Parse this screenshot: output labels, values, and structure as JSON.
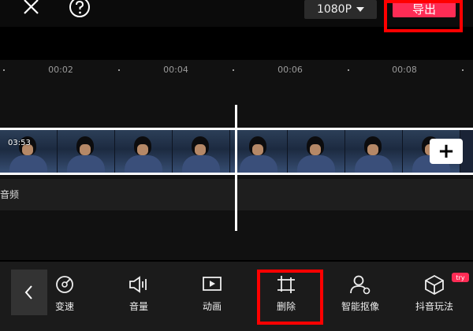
{
  "header": {
    "resolution_label": "1080P",
    "export_label": "导出"
  },
  "timeline": {
    "ticks": [
      "00:02",
      "00:04",
      "00:06",
      "00:08"
    ],
    "clip_duration": "03:53",
    "audio_label": "音频",
    "add_label": "+"
  },
  "toolbar": {
    "items": [
      {
        "label": "变速",
        "icon": "speed-icon"
      },
      {
        "label": "音量",
        "icon": "volume-icon"
      },
      {
        "label": "动画",
        "icon": "animation-icon"
      },
      {
        "label": "删除",
        "icon": "crop-icon"
      },
      {
        "label": "智能抠像",
        "icon": "cutout-icon"
      },
      {
        "label": "抖音玩法",
        "icon": "box-icon"
      }
    ],
    "try_badge": "try"
  },
  "colors": {
    "accent": "#fe2c55",
    "highlight": "#ff0000"
  }
}
